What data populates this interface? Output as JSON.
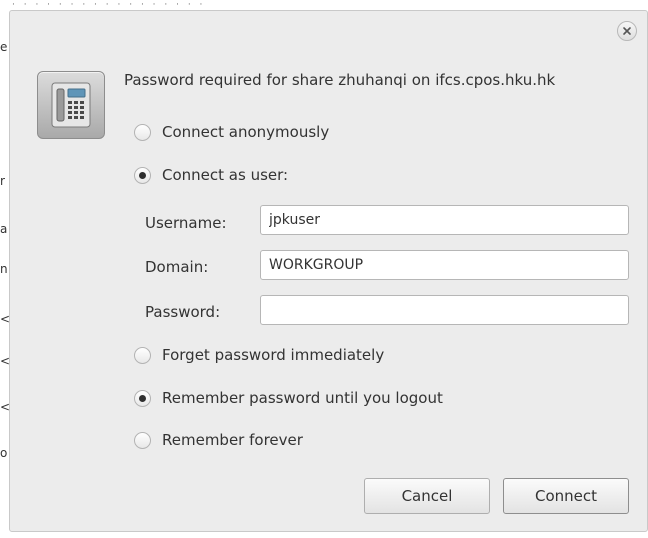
{
  "dialog": {
    "title": "Password required for share zhuhanqi on ifcs.cpos.hku.hk",
    "close_icon": "close-icon",
    "app_icon": "file-cabinet-icon"
  },
  "connect_options": [
    {
      "label": "Connect anonymously",
      "checked": false
    },
    {
      "label": "Connect as user:",
      "checked": true
    }
  ],
  "fields": {
    "username": {
      "label": "Username:",
      "value": "jpkuser"
    },
    "domain": {
      "label": "Domain:",
      "value": "WORKGROUP"
    },
    "password": {
      "label": "Password:",
      "value": ""
    }
  },
  "remember_options": [
    {
      "label": "Forget password immediately",
      "checked": false
    },
    {
      "label": "Remember password until you logout",
      "checked": true
    },
    {
      "label": "Remember forever",
      "checked": false
    }
  ],
  "buttons": {
    "cancel": "Cancel",
    "connect": "Connect"
  }
}
